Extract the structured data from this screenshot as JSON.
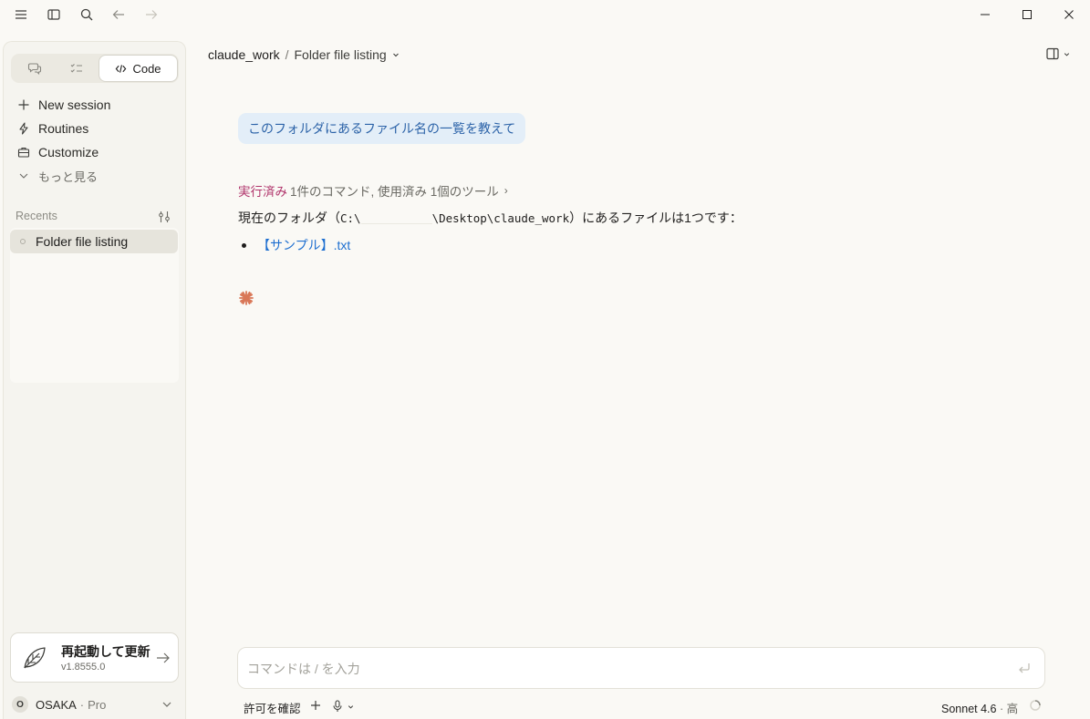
{
  "titlebar": {
    "icons": [
      "menu-icon",
      "sidebar-toggle-icon",
      "search-icon",
      "back-arrow-icon",
      "forward-arrow-icon"
    ],
    "window_controls": [
      "minimize-icon",
      "maximize-icon",
      "close-icon"
    ]
  },
  "sidebar": {
    "modes": [
      {
        "name": "chat",
        "icon": "chat-bubbles-icon"
      },
      {
        "name": "tasks",
        "icon": "checklist-icon"
      },
      {
        "name": "code",
        "label": "Code",
        "icon": "code-icon",
        "active": true
      }
    ],
    "nav": [
      {
        "label": "New session",
        "icon": "plus-icon"
      },
      {
        "label": "Routines",
        "icon": "bolt-icon"
      },
      {
        "label": "Customize",
        "icon": "briefcase-icon"
      },
      {
        "label": "もっと見る",
        "icon": "chevron-down-icon"
      }
    ],
    "recents_label": "Recents",
    "recents": [
      {
        "label": "Folder file listing",
        "active": true
      }
    ],
    "update": {
      "title": "再起動して更新",
      "version": "v1.8555.0"
    },
    "account": {
      "initial": "O",
      "name": "OSAKA",
      "separator": "·",
      "plan": "Pro"
    }
  },
  "header": {
    "project": "claude_work",
    "separator": "/",
    "session": "Folder file listing"
  },
  "conversation": {
    "user_message": "このフォルダにあるファイル名の一覧を教えて",
    "tool_summary": {
      "status": "実行済み",
      "detail": "1件のコマンド, 使用済み 1個のツール",
      "chevron": "›"
    },
    "answer": {
      "prefix": "現在のフォルダ（",
      "path_start": "C:\\",
      "path_end": "\\Desktop\\claude_work",
      "suffix": "）にあるファイルは1つです："
    },
    "files": [
      "【サンプル】.txt"
    ]
  },
  "composer": {
    "placeholder": "コマンドは / を入力",
    "permission_label": "許可を確認",
    "model_name": "Sonnet 4.6",
    "model_separator": " · ",
    "model_effort": "高"
  },
  "colors": {
    "background": "#faf9f5",
    "user_bubble": "#e3eef8",
    "user_text": "#2c63a8",
    "tool_status": "#b0346b",
    "link": "#1e6fd0",
    "spark": "#d97757"
  }
}
